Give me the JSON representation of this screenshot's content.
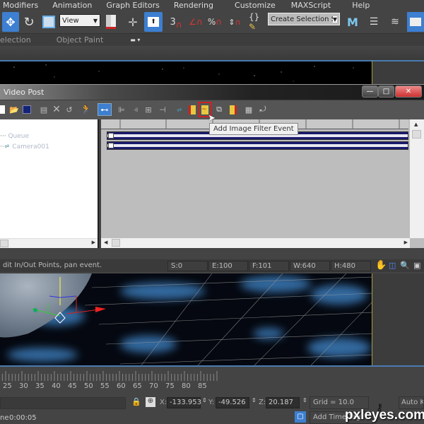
{
  "menubar": [
    "Modifiers",
    "Animation",
    "Graph Editors",
    "Rendering",
    "Customize",
    "MAXScript",
    "Help"
  ],
  "main_toolbar": {
    "view_dropdown": "View",
    "selection_set_dropdown": "Create Selection Se",
    "snap_label_3": "3",
    "colors": {
      "accent": "#3d7fd0",
      "bg": "#444444"
    }
  },
  "ribbon": {
    "tabs": [
      "election",
      "Object Paint"
    ]
  },
  "video_post": {
    "title": "Video Post",
    "window_buttons": {
      "minimize": "—",
      "maximize": "□",
      "close": "✕"
    },
    "tree": {
      "items": [
        "Queue",
        "Camera001"
      ]
    },
    "tooltip": "Add Image Filter Event",
    "status": {
      "message": "dit In/Out Points, pan event.",
      "start": "S:0",
      "end": "E:100",
      "frames": "F:101",
      "width": "W:640",
      "height": "H:480"
    }
  },
  "timeline": {
    "tick_labels": [
      "25",
      "30",
      "35",
      "40",
      "45",
      "50",
      "55",
      "60",
      "65",
      "70",
      "75",
      "80",
      "85"
    ],
    "coords": {
      "x_label": "X:",
      "x": "-133.953",
      "y_label": "Y:",
      "y": "-49.526",
      "z_label": "Z:",
      "z": "20.187"
    },
    "grid": "Grid = 10.0",
    "auto_key": "Auto Ke",
    "add_time_tag": "Add Time Tag",
    "time_label": "ne",
    "time_value": "0:00:05"
  },
  "watermark": "pxleyes.com"
}
